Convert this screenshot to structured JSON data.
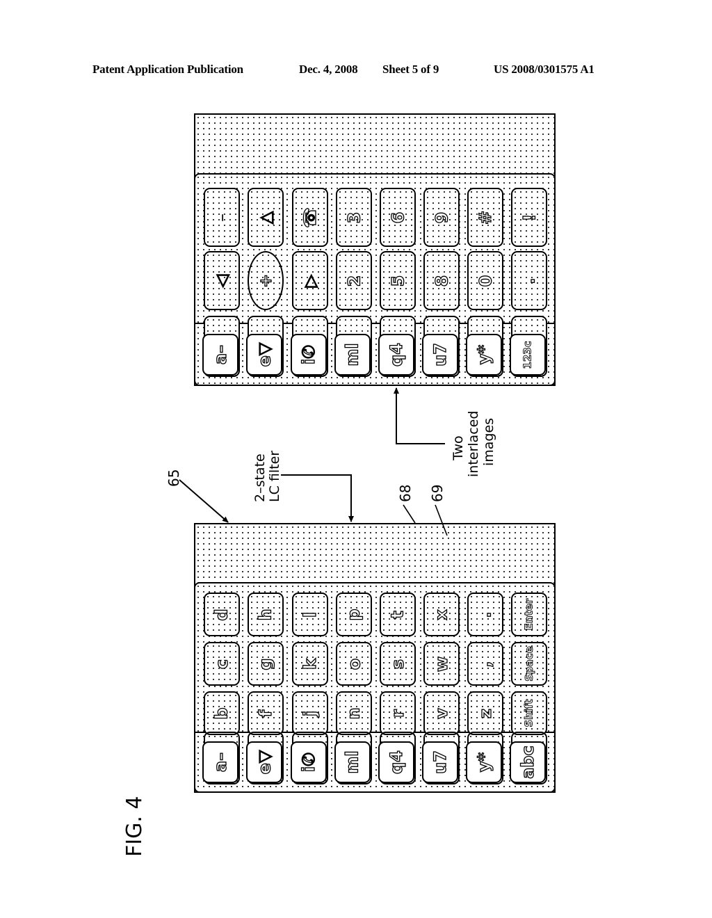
{
  "header": {
    "left": "Patent Application Publication",
    "date": "Dec. 4, 2008",
    "sheet": "Sheet 5 of 9",
    "number": "US 2008/0301575 A1"
  },
  "figure": {
    "label": "FIG. 4",
    "annotations": {
      "ref_65": "65",
      "lc_filter_line1": "2–state",
      "lc_filter_line2": "LC filter",
      "ref_68": "68",
      "ref_69": "69",
      "interlaced_line1": "Two",
      "interlaced_line2": "interlaced",
      "interlaced_line3": "images"
    }
  },
  "keypad_numeric": {
    "description": "Upper keypad (second image state)",
    "columns": [
      {
        "top": "–",
        "mid": "◁",
        "tab": "a–"
      },
      {
        "top": "△",
        "mid": "+",
        "tab": "e▽"
      },
      {
        "top": "☎",
        "mid": "▷",
        "tab": "i✆"
      },
      {
        "top": "3",
        "mid": "2",
        "tab": "ml"
      },
      {
        "top": "6",
        "mid": "5",
        "tab": "q4"
      },
      {
        "top": "9",
        "mid": "8",
        "tab": "u7"
      },
      {
        "top": "#",
        "mid": "0",
        "tab": "y*"
      },
      {
        "top": "!",
        "mid": ".",
        "tab": "123c"
      }
    ]
  },
  "keypad_alpha": {
    "description": "Lower keypad (first image state)",
    "columns": [
      {
        "top": "d",
        "mid": "c",
        "low": "b",
        "tab": "a–"
      },
      {
        "top": "h",
        "mid": "g",
        "low": "f",
        "tab": "e▽"
      },
      {
        "top": "l",
        "mid": "k",
        "low": "j",
        "tab": "i✆"
      },
      {
        "top": "p",
        "mid": "o",
        "low": "n",
        "tab": "ml"
      },
      {
        "top": "t",
        "mid": "s",
        "low": "r",
        "tab": "q4"
      },
      {
        "top": "x",
        "mid": "w",
        "low": "v",
        "tab": "u7"
      },
      {
        "top": ".",
        "mid": ",",
        "low": "z",
        "tab": "y*"
      },
      {
        "top": "Enter",
        "mid": "Space",
        "low": "Shift",
        "tab": "abc"
      }
    ]
  }
}
